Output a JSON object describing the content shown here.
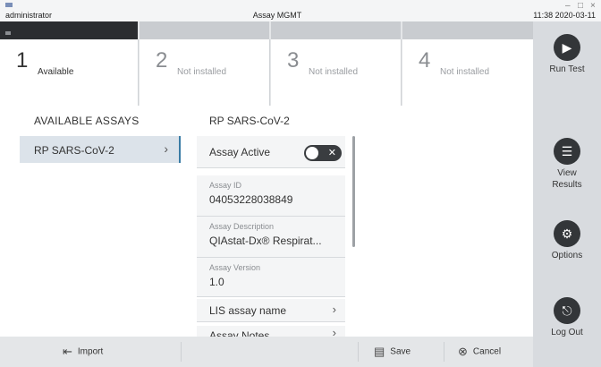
{
  "titlebar": {
    "user": "administrator",
    "center": "Assay MGMT",
    "clock": "11:38 2020-03-11"
  },
  "tabs": [
    {
      "number": "1",
      "label": "Available"
    },
    {
      "number": "2",
      "label": "Not installed"
    },
    {
      "number": "3",
      "label": "Not installed"
    },
    {
      "number": "4",
      "label": "Not installed"
    }
  ],
  "sidebar": {
    "run_test": "Run Test",
    "view_results_1": "View",
    "view_results_2": "Results",
    "options": "Options",
    "log_out": "Log Out"
  },
  "left": {
    "header": "AVAILABLE ASSAYS",
    "items": [
      {
        "label": "RP SARS-CoV-2"
      }
    ]
  },
  "detail": {
    "title": "RP SARS-CoV-2",
    "active_label": "Assay Active",
    "assay_id_caption": "Assay ID",
    "assay_id": "04053228038849",
    "assay_desc_caption": "Assay Description",
    "assay_desc": "QIAstat-Dx® Respirat...",
    "assay_version_caption": "Assay Version",
    "assay_version": "1.0",
    "lis_label": "LIS assay name",
    "notes_label": "Assay Notes"
  },
  "bottom": {
    "import": "Import",
    "save": "Save",
    "cancel": "Cancel"
  },
  "colors": {
    "accent": "#3a7ca5",
    "dark_button": "#333639"
  }
}
